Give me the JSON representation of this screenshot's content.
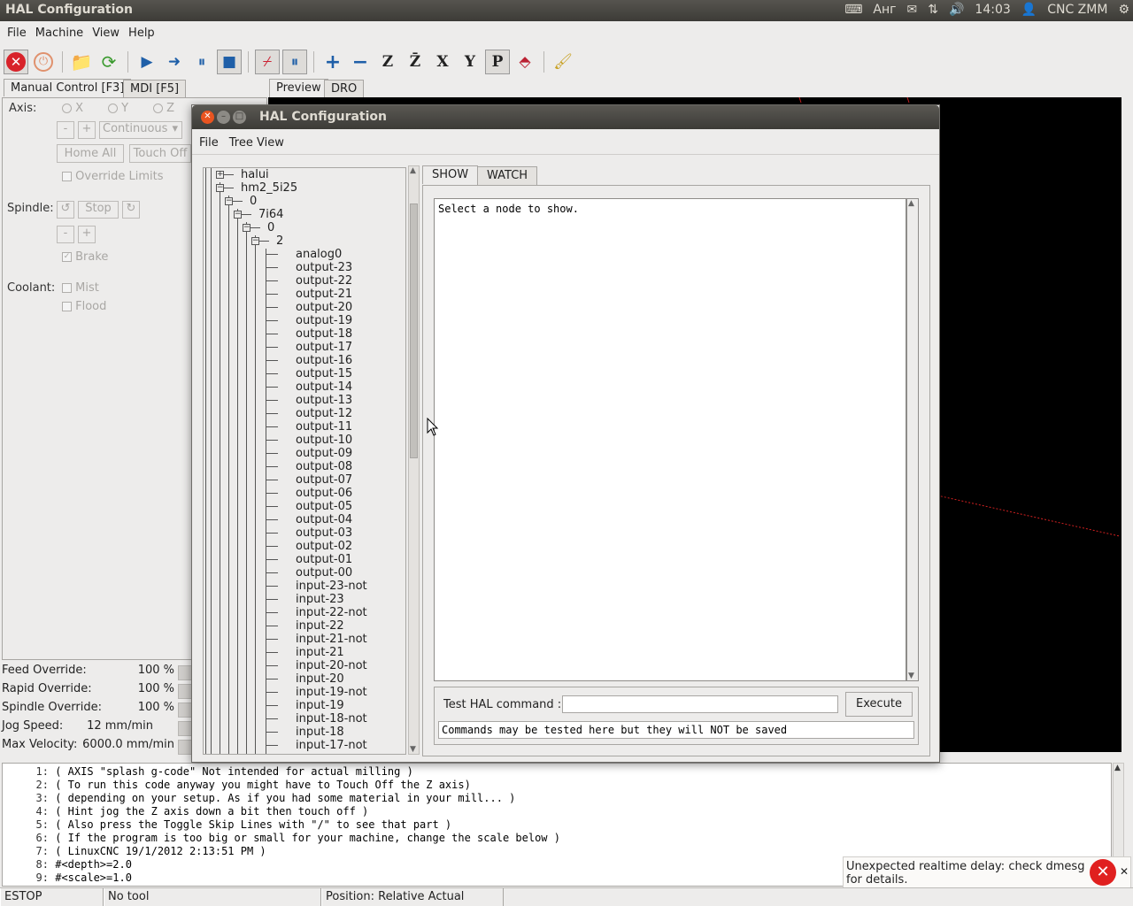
{
  "top_panel": {
    "title": "HAL Configuration",
    "keyboard_layout": "Анг",
    "clock": "14:03",
    "user": "CNC ZMM"
  },
  "menubar": [
    "File",
    "Machine",
    "View",
    "Help"
  ],
  "left_tabs": [
    "Manual Control [F3]",
    "MDI [F5]"
  ],
  "manual": {
    "axis_label": "Axis:",
    "axes": [
      "X",
      "Y",
      "Z"
    ],
    "minus": "-",
    "plus": "+",
    "jog_mode": "Continuous",
    "home_all": "Home All",
    "touch_off": "Touch Off",
    "override_limits": "Override Limits",
    "spindle_label": "Spindle:",
    "stop": "Stop",
    "brake": "Brake",
    "coolant_label": "Coolant:",
    "mist": "Mist",
    "flood": "Flood"
  },
  "overrides": [
    {
      "label": "Feed Override:",
      "value": "100 %"
    },
    {
      "label": "Rapid Override:",
      "value": "100 %"
    },
    {
      "label": "Spindle Override:",
      "value": "100 %"
    },
    {
      "label": "Jog Speed:",
      "value": "12 mm/min"
    },
    {
      "label": "Max Velocity:",
      "value": "6000.0 mm/min"
    }
  ],
  "preview_tabs": [
    "Preview",
    "DRO"
  ],
  "code_lines": [
    {
      "n": "1:",
      "text": "( AXIS \"splash g-code\" Not intended for actual milling )"
    },
    {
      "n": "2:",
      "text": "( To run this code anyway you might have to Touch Off the Z axis)"
    },
    {
      "n": "3:",
      "text": "( depending on your setup. As if you had some material in your mill... )"
    },
    {
      "n": "4:",
      "text": "( Hint jog the Z axis down a bit then touch off )"
    },
    {
      "n": "5:",
      "text": "( Also press the Toggle Skip Lines with \"/\" to see that part )"
    },
    {
      "n": "6:",
      "text": "( If the program is too big or small for your machine, change the scale below )"
    },
    {
      "n": "7:",
      "text": "( LinuxCNC 19/1/2012 2:13:51 PM )"
    },
    {
      "n": "8:",
      "text": "#<depth>=2.0"
    },
    {
      "n": "9:",
      "text": "#<scale>=1.0"
    }
  ],
  "status": {
    "estop": "ESTOP",
    "tool": "No tool",
    "position": "Position: Relative Actual"
  },
  "notification": "Unexpected realtime delay: check dmesg for details.",
  "hal": {
    "title": "HAL Configuration",
    "menu": [
      "File",
      "Tree View"
    ],
    "tree_top": [
      {
        "label": "halui",
        "level": 0
      },
      {
        "label": "hm2_5i25",
        "level": 0
      },
      {
        "label": "0",
        "level": 1
      },
      {
        "label": "7i64",
        "level": 2
      },
      {
        "label": "0",
        "level": 3
      },
      {
        "label": "2",
        "level": 4
      }
    ],
    "tree_leaves": [
      "analog0",
      "output-23",
      "output-22",
      "output-21",
      "output-20",
      "output-19",
      "output-18",
      "output-17",
      "output-16",
      "output-15",
      "output-14",
      "output-13",
      "output-12",
      "output-11",
      "output-10",
      "output-09",
      "output-08",
      "output-07",
      "output-06",
      "output-05",
      "output-04",
      "output-03",
      "output-02",
      "output-01",
      "output-00",
      "input-23-not",
      "input-23",
      "input-22-not",
      "input-22",
      "input-21-not",
      "input-21",
      "input-20-not",
      "input-20",
      "input-19-not",
      "input-19",
      "input-18-not",
      "input-18",
      "input-17-not"
    ],
    "tabs": [
      "SHOW",
      "WATCH"
    ],
    "show_text": "Select a node to show.",
    "test_label": "Test HAL command :",
    "execute": "Execute",
    "note": "Commands may be tested here but they will NOT be saved"
  }
}
